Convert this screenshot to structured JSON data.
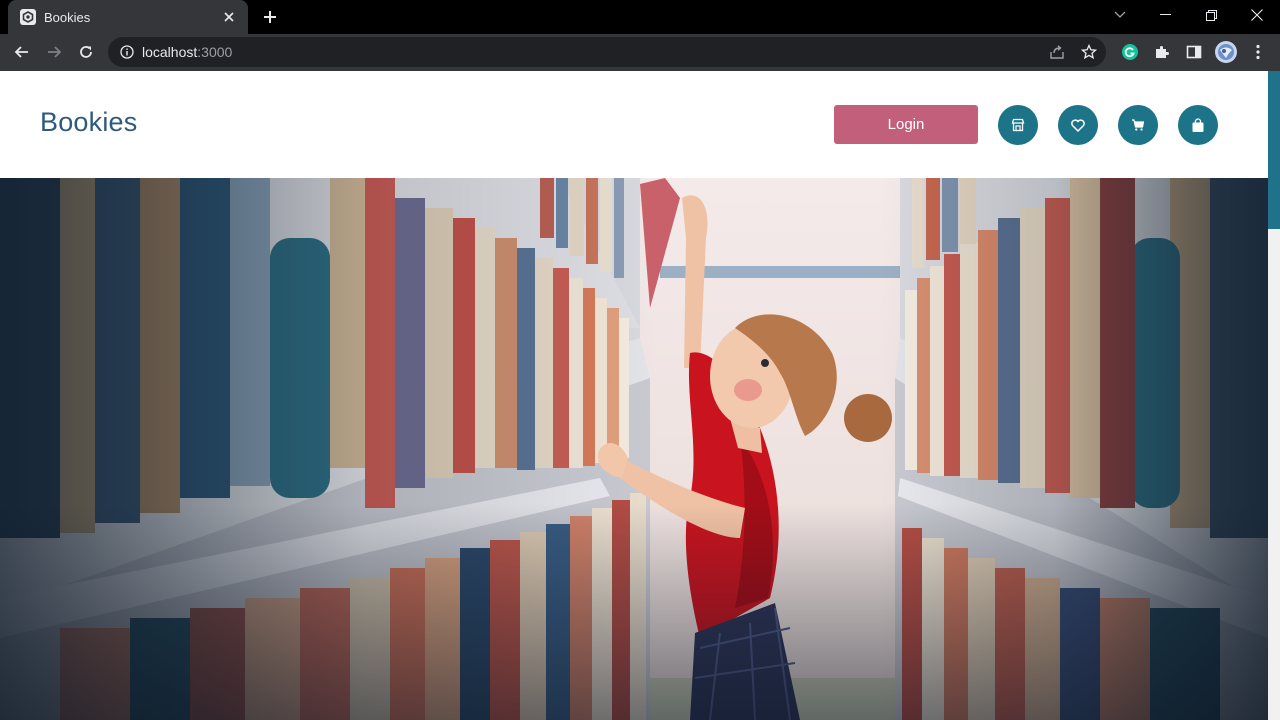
{
  "browser": {
    "tab_title": "Bookies",
    "url_host": "localhost",
    "url_port": ":3000",
    "icons": [
      "favicon-icon",
      "tab-close-icon",
      "new-tab-icon",
      "chevron-down-icon",
      "minimize-icon",
      "restore-icon",
      "close-window-icon",
      "back-icon",
      "forward-icon",
      "reload-icon",
      "site-info-icon",
      "share-icon",
      "star-icon",
      "grammarly-icon",
      "extensions-icon",
      "side-panel-icon",
      "profile-avatar",
      "menu-icon"
    ]
  },
  "header": {
    "brand": "Bookies",
    "login_label": "Login",
    "action_icons": [
      "store-icon",
      "heart-icon",
      "cart-icon",
      "bag-icon"
    ]
  },
  "colors": {
    "brand_text": "#2d5a7d",
    "login_bg": "#c2607b",
    "icon_circle": "#1d7388",
    "chrome_dark": "#35363a"
  },
  "hero": {
    "image": "library-illustration"
  }
}
